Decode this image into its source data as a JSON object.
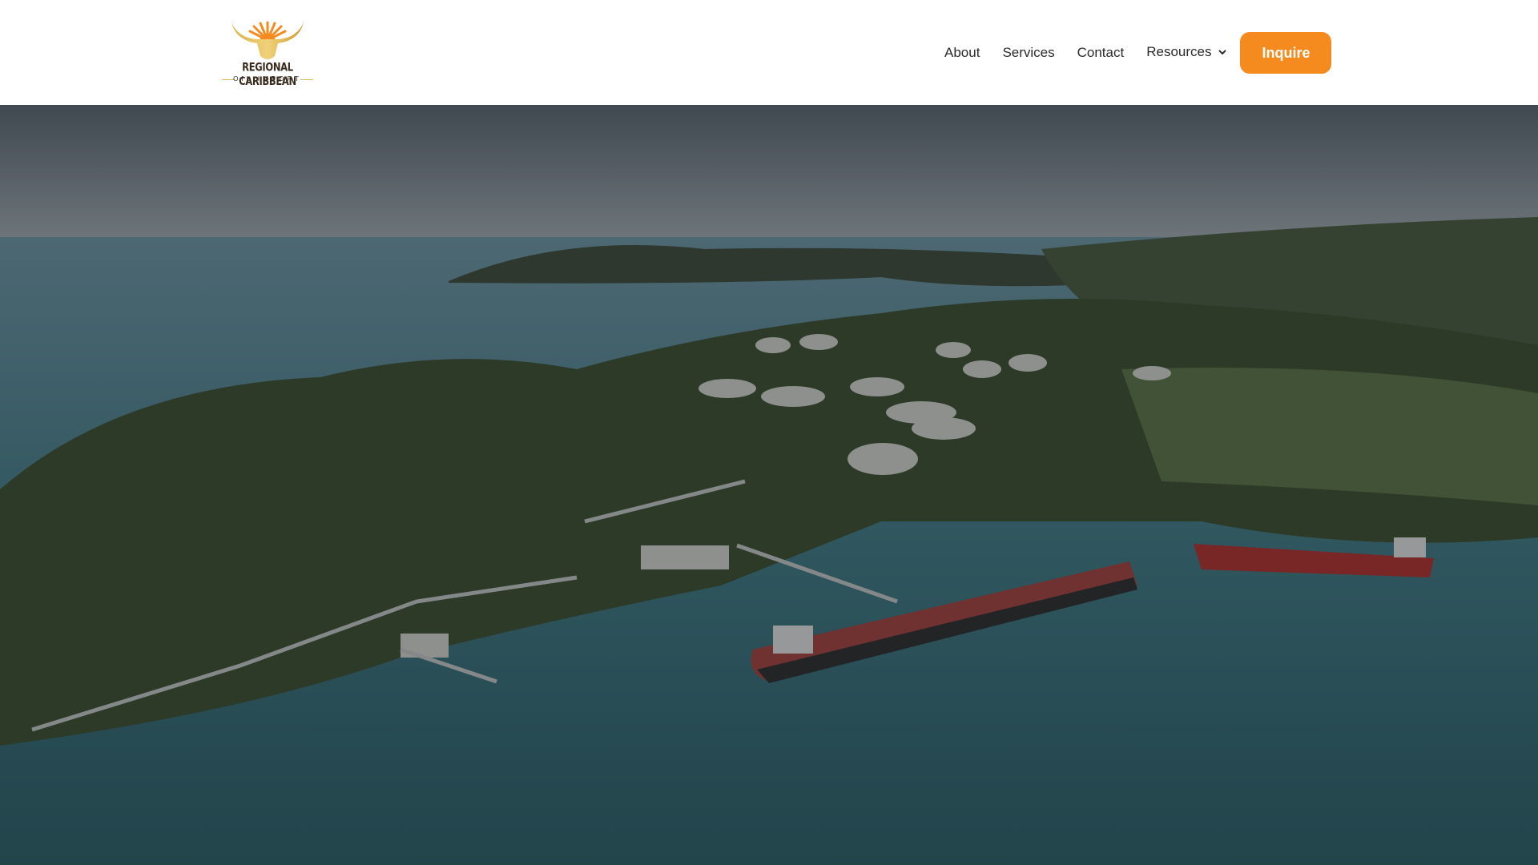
{
  "brand": {
    "name_line1": "REGIONAL CARIBBEAN",
    "name_line2": "OIL IMPORT"
  },
  "nav": {
    "items": [
      {
        "label": "About"
      },
      {
        "label": "Services"
      },
      {
        "label": "Contact"
      },
      {
        "label": "Resources",
        "has_dropdown": true
      }
    ],
    "cta": "Inquire"
  },
  "colors": {
    "accent": "#f58a1f",
    "text": "#2b2b2b"
  },
  "hero": {
    "image": "aerial-oil-terminal-port"
  }
}
